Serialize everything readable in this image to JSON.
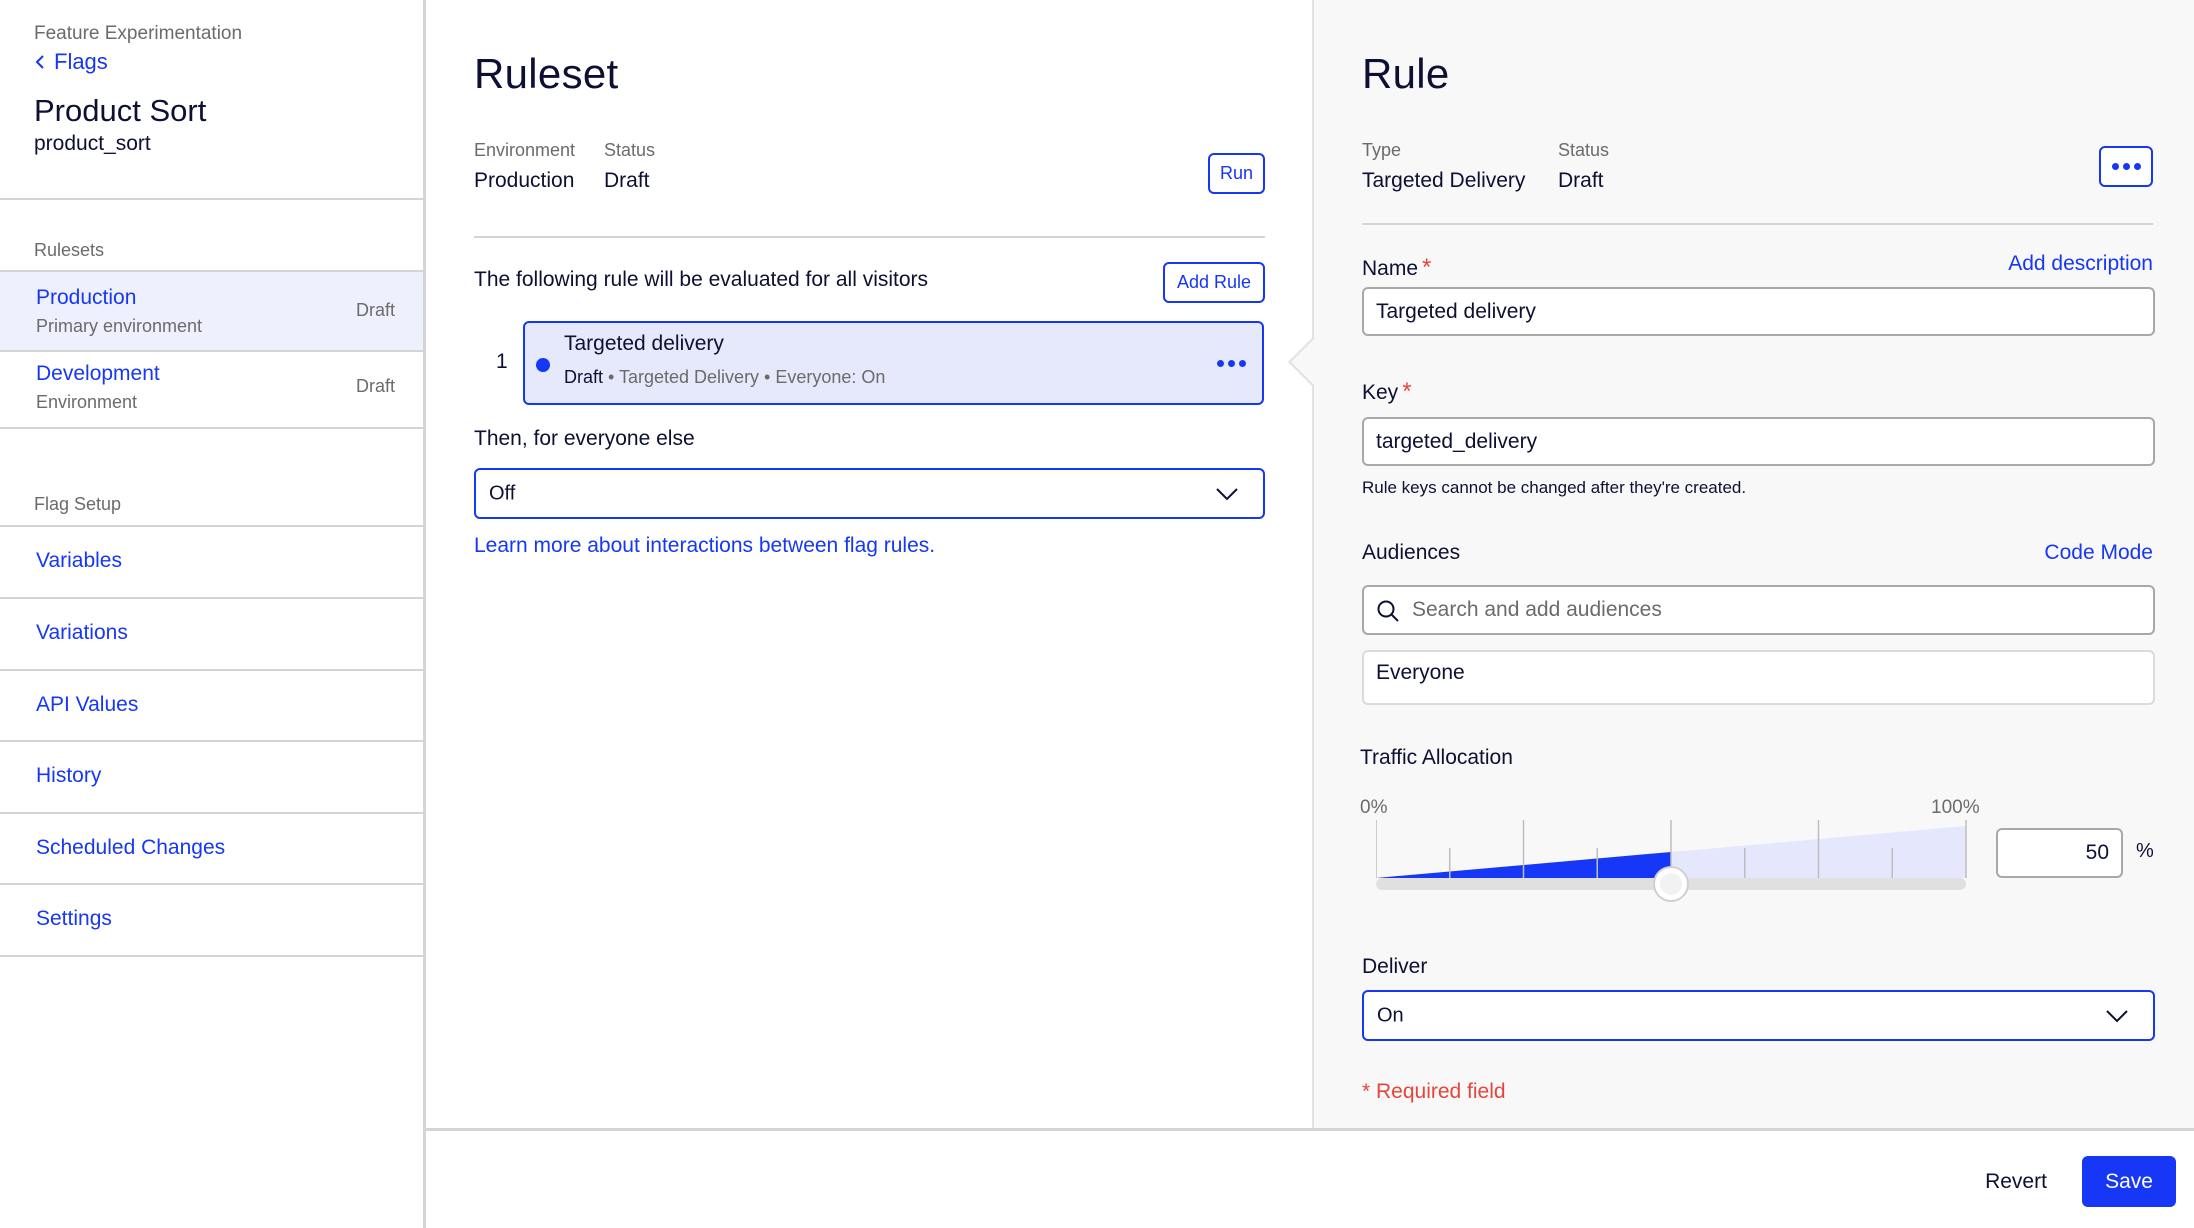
{
  "sidebar": {
    "product": "Feature Experimentation",
    "back_label": "Flags",
    "flag_name": "Product Sort",
    "flag_key": "product_sort",
    "rulesets_heading": "Rulesets",
    "environments": [
      {
        "name": "Production",
        "subtitle": "Primary environment",
        "status": "Draft",
        "active": true
      },
      {
        "name": "Development",
        "subtitle": "Environment",
        "status": "Draft",
        "active": false
      }
    ],
    "setup_heading": "Flag Setup",
    "nav": [
      "Variables",
      "Variations",
      "API Values",
      "History",
      "Scheduled Changes",
      "Settings"
    ]
  },
  "ruleset": {
    "title": "Ruleset",
    "environment_label": "Environment",
    "environment_value": "Production",
    "status_label": "Status",
    "status_value": "Draft",
    "run_label": "Run",
    "intro": "The following rule will be evaluated for all visitors",
    "add_rule_label": "Add Rule",
    "rules": [
      {
        "index": "1",
        "name": "Targeted delivery",
        "status": "Draft",
        "details": " • Targeted Delivery • Everyone: On"
      }
    ],
    "else_label": "Then, for everyone else",
    "else_value": "Off",
    "learn_more": "Learn more about interactions between flag rules."
  },
  "rule": {
    "title": "Rule",
    "type_label": "Type",
    "type_value": "Targeted Delivery",
    "status_label": "Status",
    "status_value": "Draft",
    "name_label": "Name",
    "add_description": "Add description",
    "name_value": "Targeted delivery",
    "key_label": "Key",
    "key_value": "targeted_delivery",
    "key_helper": "Rule keys cannot be changed after they're created.",
    "audiences_label": "Audiences",
    "code_mode": "Code Mode",
    "audience_placeholder": "Search and add audiences",
    "audiences": [
      "Everyone"
    ],
    "traffic_label": "Traffic Allocation",
    "traffic_min_label": "0%",
    "traffic_max_label": "100%",
    "traffic_percent": 50,
    "traffic_value": "50",
    "percent_sign": "%",
    "deliver_label": "Deliver",
    "deliver_value": "On",
    "required_note": "* Required field"
  },
  "footer": {
    "revert_label": "Revert",
    "save_label": "Save"
  },
  "colors": {
    "accent": "#1637f5",
    "selected_bg": "#e6e9fc",
    "required": "#e5463b"
  }
}
